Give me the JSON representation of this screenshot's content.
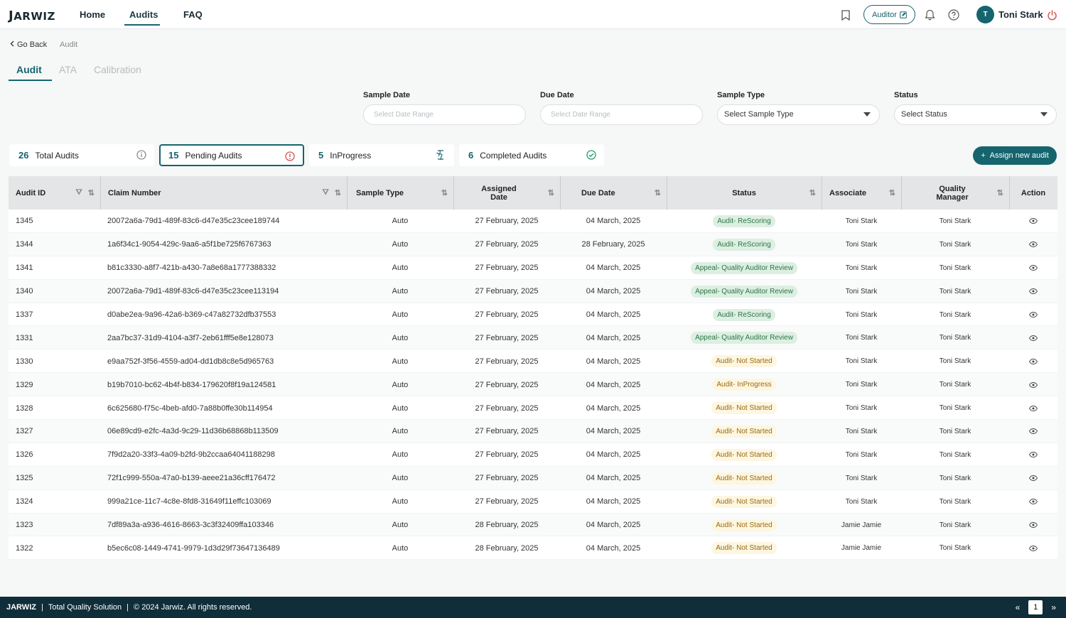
{
  "brand": {
    "logo_text": "ARWIZ",
    "logo_initial": "J"
  },
  "nav": {
    "home": "Home",
    "audits": "Audits",
    "faq": "FAQ"
  },
  "user": {
    "role": "Auditor",
    "avatar_initial": "T",
    "name": "Toni Stark"
  },
  "breadcrumb": {
    "back": "Go Back",
    "current": "Audit"
  },
  "tabs": [
    "Audit",
    "ATA",
    "Calibration"
  ],
  "filters": {
    "sample_date": {
      "label": "Sample Date",
      "placeholder": "Select Date Range"
    },
    "due_date": {
      "label": "Due Date",
      "placeholder": "Select Date Range"
    },
    "sample_type": {
      "label": "Sample Type",
      "value": "Select Sample Type"
    },
    "status": {
      "label": "Status",
      "value": "Select Status"
    }
  },
  "stats": [
    {
      "count": "26",
      "label": "Total Audits"
    },
    {
      "count": "15",
      "label": "Pending Audits"
    },
    {
      "count": "5",
      "label": "InProgress"
    },
    {
      "count": "6",
      "label": "Completed Audits"
    }
  ],
  "assign_button": "Assign new audit",
  "table": {
    "headers": {
      "audit_id": "Audit ID",
      "claim_number": "Claim Number",
      "sample_type": "Sample Type",
      "assigned_date_1": "Assigned",
      "assigned_date_2": "Date",
      "due_date": "Due Date",
      "status": "Status",
      "associate": "Associate",
      "quality_manager_1": "Quality",
      "quality_manager_2": "Manager",
      "action": "Action"
    },
    "rows": [
      {
        "id": "1345",
        "claim": "20072a6a-79d1-489f-83c6-d47e35c23cee189744",
        "type": "Auto",
        "assigned": "27 February, 2025",
        "due": "04 March, 2025",
        "status": "Audit- ReScoring",
        "associate": "Toni Stark",
        "manager": "Toni Stark"
      },
      {
        "id": "1344",
        "claim": "1a6f34c1-9054-429c-9aa6-a5f1be725f6767363",
        "type": "Auto",
        "assigned": "27 February, 2025",
        "due": "28 February, 2025",
        "status": "Audit- ReScoring",
        "associate": "Toni Stark",
        "manager": "Toni Stark"
      },
      {
        "id": "1341",
        "claim": "b81c3330-a8f7-421b-a430-7a8e68a1777388332",
        "type": "Auto",
        "assigned": "27 February, 2025",
        "due": "04 March, 2025",
        "status": "Appeal- Quality Auditor Review",
        "associate": "Toni Stark",
        "manager": "Toni Stark"
      },
      {
        "id": "1340",
        "claim": "20072a6a-79d1-489f-83c6-d47e35c23cee113194",
        "type": "Auto",
        "assigned": "27 February, 2025",
        "due": "04 March, 2025",
        "status": "Appeal- Quality Auditor Review",
        "associate": "Toni Stark",
        "manager": "Toni Stark"
      },
      {
        "id": "1337",
        "claim": "d0abe2ea-9a96-42a6-b369-c47a82732dfb37553",
        "type": "Auto",
        "assigned": "27 February, 2025",
        "due": "04 March, 2025",
        "status": "Audit- ReScoring",
        "associate": "Toni Stark",
        "manager": "Toni Stark"
      },
      {
        "id": "1331",
        "claim": "2aa7bc37-31d9-4104-a3f7-2eb61fff5e8e128073",
        "type": "Auto",
        "assigned": "27 February, 2025",
        "due": "04 March, 2025",
        "status": "Appeal- Quality Auditor Review",
        "associate": "Toni Stark",
        "manager": "Toni Stark"
      },
      {
        "id": "1330",
        "claim": "e9aa752f-3f56-4559-ad04-dd1db8c8e5d965763",
        "type": "Auto",
        "assigned": "27 February, 2025",
        "due": "04 March, 2025",
        "status": "Audit- Not Started",
        "associate": "Toni Stark",
        "manager": "Toni Stark"
      },
      {
        "id": "1329",
        "claim": "b19b7010-bc62-4b4f-b834-179620f8f19a124581",
        "type": "Auto",
        "assigned": "27 February, 2025",
        "due": "04 March, 2025",
        "status": "Audit- InProgress",
        "associate": "Toni Stark",
        "manager": "Toni Stark"
      },
      {
        "id": "1328",
        "claim": "6c625680-f75c-4beb-afd0-7a88b0ffe30b114954",
        "type": "Auto",
        "assigned": "27 February, 2025",
        "due": "04 March, 2025",
        "status": "Audit- Not Started",
        "associate": "Toni Stark",
        "manager": "Toni Stark"
      },
      {
        "id": "1327",
        "claim": "06e89cd9-e2fc-4a3d-9c29-11d36b68868b113509",
        "type": "Auto",
        "assigned": "27 February, 2025",
        "due": "04 March, 2025",
        "status": "Audit- Not Started",
        "associate": "Toni Stark",
        "manager": "Toni Stark"
      },
      {
        "id": "1326",
        "claim": "7f9d2a20-33f3-4a09-b2fd-9b2ccaa64041188298",
        "type": "Auto",
        "assigned": "27 February, 2025",
        "due": "04 March, 2025",
        "status": "Audit- Not Started",
        "associate": "Toni Stark",
        "manager": "Toni Stark"
      },
      {
        "id": "1325",
        "claim": "72f1c999-550a-47a0-b139-aeee21a36cff176472",
        "type": "Auto",
        "assigned": "27 February, 2025",
        "due": "04 March, 2025",
        "status": "Audit- Not Started",
        "associate": "Toni Stark",
        "manager": "Toni Stark"
      },
      {
        "id": "1324",
        "claim": "999a21ce-11c7-4c8e-8fd8-31649f11effc103069",
        "type": "Auto",
        "assigned": "27 February, 2025",
        "due": "04 March, 2025",
        "status": "Audit- Not Started",
        "associate": "Toni Stark",
        "manager": "Toni Stark"
      },
      {
        "id": "1323",
        "claim": "7df89a3a-a936-4616-8663-3c3f32409ffa103346",
        "type": "Auto",
        "assigned": "28 February, 2025",
        "due": "04 March, 2025",
        "status": "Audit- Not Started",
        "associate": "Jamie Jamie",
        "manager": "Toni Stark"
      },
      {
        "id": "1322",
        "claim": "b5ec6c08-1449-4741-9979-1d3d29f73647136489",
        "type": "Auto",
        "assigned": "28 February, 2025",
        "due": "04 March, 2025",
        "status": "Audit- Not Started",
        "associate": "Jamie Jamie",
        "manager": "Toni Stark"
      }
    ]
  },
  "footer": {
    "brand": "JARWIZ",
    "tagline": "Total Quality Solution",
    "copyright": "© 2024 Jarwiz. All rights reserved.",
    "page": "1"
  },
  "colors": {
    "accent": "#15646e",
    "footer_bg": "#0f2e3a",
    "badge_green": "#dcefe2",
    "badge_yellow": "#fdf6e0"
  }
}
